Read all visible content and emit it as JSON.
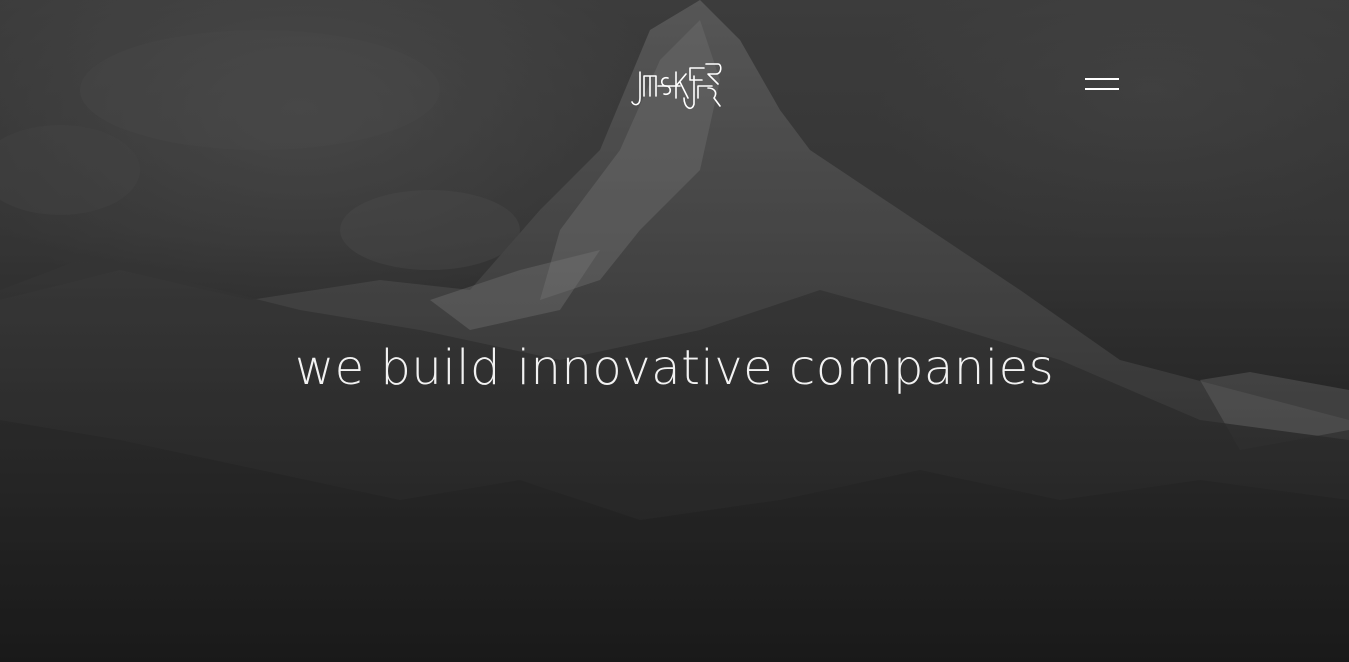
{
  "brand": {
    "logo_icon": "maker-logo-icon"
  },
  "nav": {
    "menu_icon": "hamburger-icon"
  },
  "hero": {
    "headline": "we build innovative companies",
    "background": "mountain-photo-dark"
  },
  "colors": {
    "text": "#ffffff",
    "overlay": "#1c1c1c"
  }
}
